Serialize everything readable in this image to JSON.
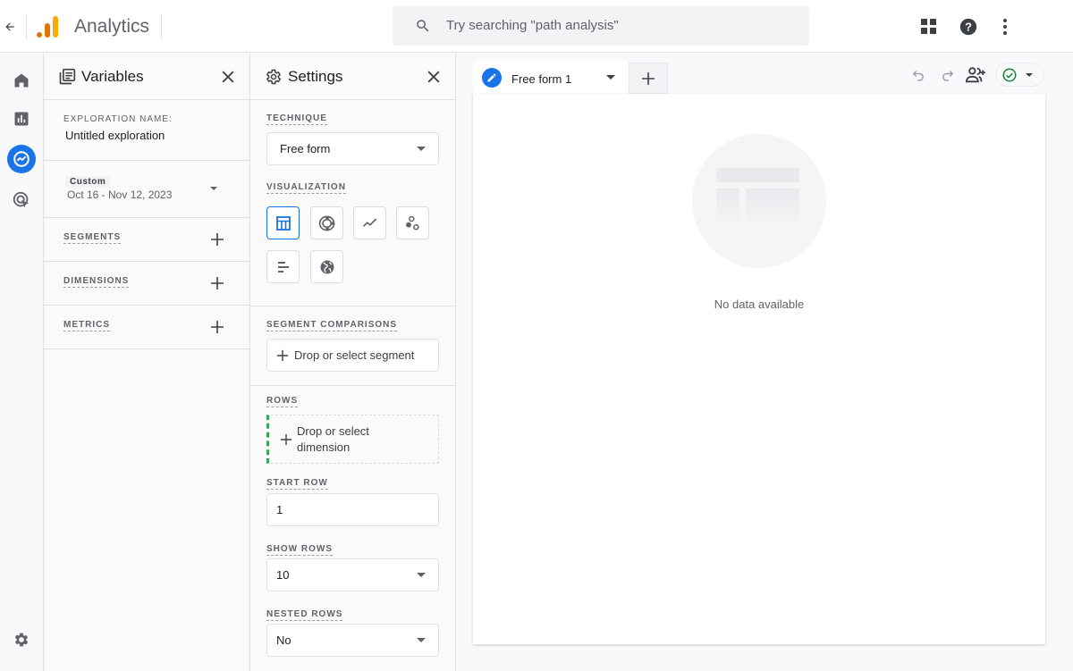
{
  "app": {
    "title": "Analytics"
  },
  "search": {
    "placeholder": "Try searching \"path analysis\""
  },
  "topbar": {
    "icons": [
      "back-arrow-icon",
      "analytics-logo-icon",
      "apps-grid-icon",
      "help-icon",
      "more-vert-icon"
    ]
  },
  "leftnav": {
    "items": [
      {
        "name": "home",
        "icon": "home-icon"
      },
      {
        "name": "reports",
        "icon": "bar-chart-icon"
      },
      {
        "name": "explore",
        "icon": "explore-icon",
        "active": true
      },
      {
        "name": "advertising",
        "icon": "target-cursor-icon"
      }
    ],
    "settings_icon": "gear-icon"
  },
  "variables": {
    "title": "Variables",
    "exploration_name_label": "EXPLORATION NAME:",
    "exploration_name": "Untitled exploration",
    "date_chip": "Custom",
    "date_range": "Oct 16 - Nov 12, 2023",
    "segments_label": "SEGMENTS",
    "dimensions_label": "DIMENSIONS",
    "metrics_label": "METRICS"
  },
  "settings": {
    "title": "Settings",
    "technique_label": "TECHNIQUE",
    "technique_value": "Free form",
    "visualization_label": "VISUALIZATION",
    "visualizations": [
      {
        "name": "table",
        "selected": true
      },
      {
        "name": "donut"
      },
      {
        "name": "line"
      },
      {
        "name": "scatter"
      },
      {
        "name": "bar"
      },
      {
        "name": "geo"
      }
    ],
    "segment_comparisons_label": "SEGMENT COMPARISONS",
    "segment_drop": "Drop or select segment",
    "rows_label": "ROWS",
    "rows_drop_line1": "Drop or select",
    "rows_drop_line2": "dimension",
    "start_row_label": "START ROW",
    "start_row_value": "1",
    "show_rows_label": "SHOW ROWS",
    "show_rows_value": "10",
    "nested_rows_label": "NESTED ROWS",
    "nested_rows_value": "No"
  },
  "canvas": {
    "tab_label": "Free form 1",
    "empty_message": "No data available"
  },
  "colors": {
    "accent": "#1a73e8",
    "success": "#188038",
    "logo_orange": "#f9ab00",
    "logo_dark": "#e37400",
    "rows_green": "#34a853"
  }
}
